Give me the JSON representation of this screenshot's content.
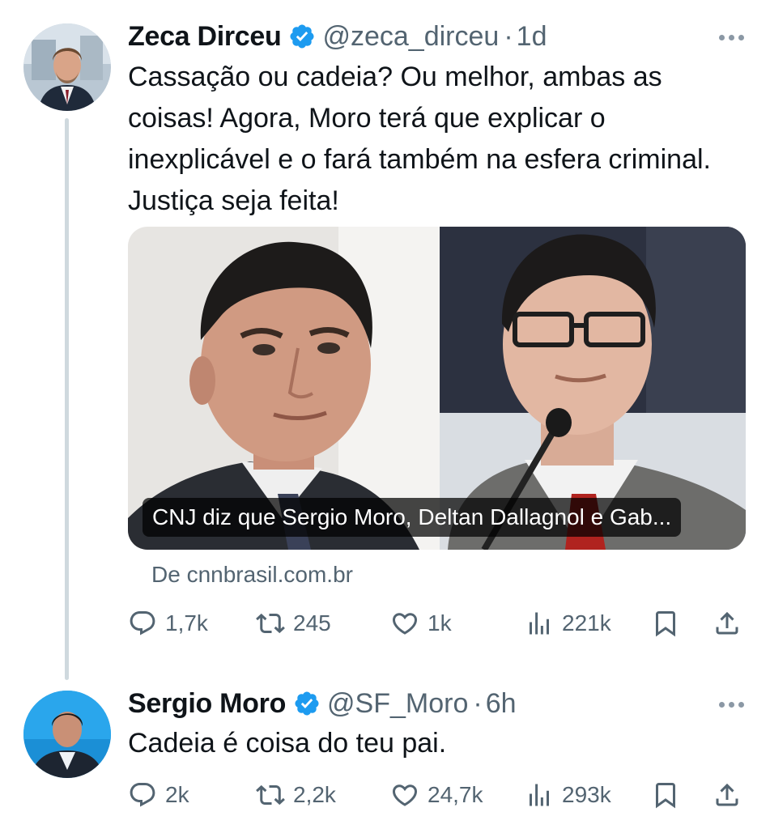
{
  "tweets": [
    {
      "display_name": "Zeca Dirceu",
      "handle": "@zeca_dirceu",
      "separator": "·",
      "time": "1d",
      "text": "Cassação ou cadeia? Ou melhor, ambas as coisas! Agora, Moro terá que explicar o inexplicável e o fará também na esfera criminal. Justiça seja feita!",
      "card": {
        "caption": "CNJ diz que Sergio Moro, Deltan Dallagnol e Gab...",
        "source": "De cnnbrasil.com.br"
      },
      "stats": {
        "replies": "1,7k",
        "retweets": "245",
        "likes": "1k",
        "views": "221k"
      }
    },
    {
      "display_name": "Sergio Moro",
      "handle": "@SF_Moro",
      "separator": "·",
      "time": "6h",
      "text": "Cadeia é coisa do teu pai.",
      "stats": {
        "replies": "2k",
        "retweets": "2,2k",
        "likes": "24,7k",
        "views": "293k"
      }
    }
  ],
  "icons": {
    "verified": "verified-badge-icon",
    "more": "more-dots-icon",
    "reply": "reply-bubble-icon",
    "retweet": "retweet-icon",
    "like": "heart-icon",
    "views": "views-bars-icon",
    "bookmark": "bookmark-icon",
    "share": "share-icon"
  },
  "colors": {
    "verified": "#1d9bf0",
    "text": "#0f1419",
    "secondary": "#536471",
    "thread_line": "#cfd9de"
  }
}
